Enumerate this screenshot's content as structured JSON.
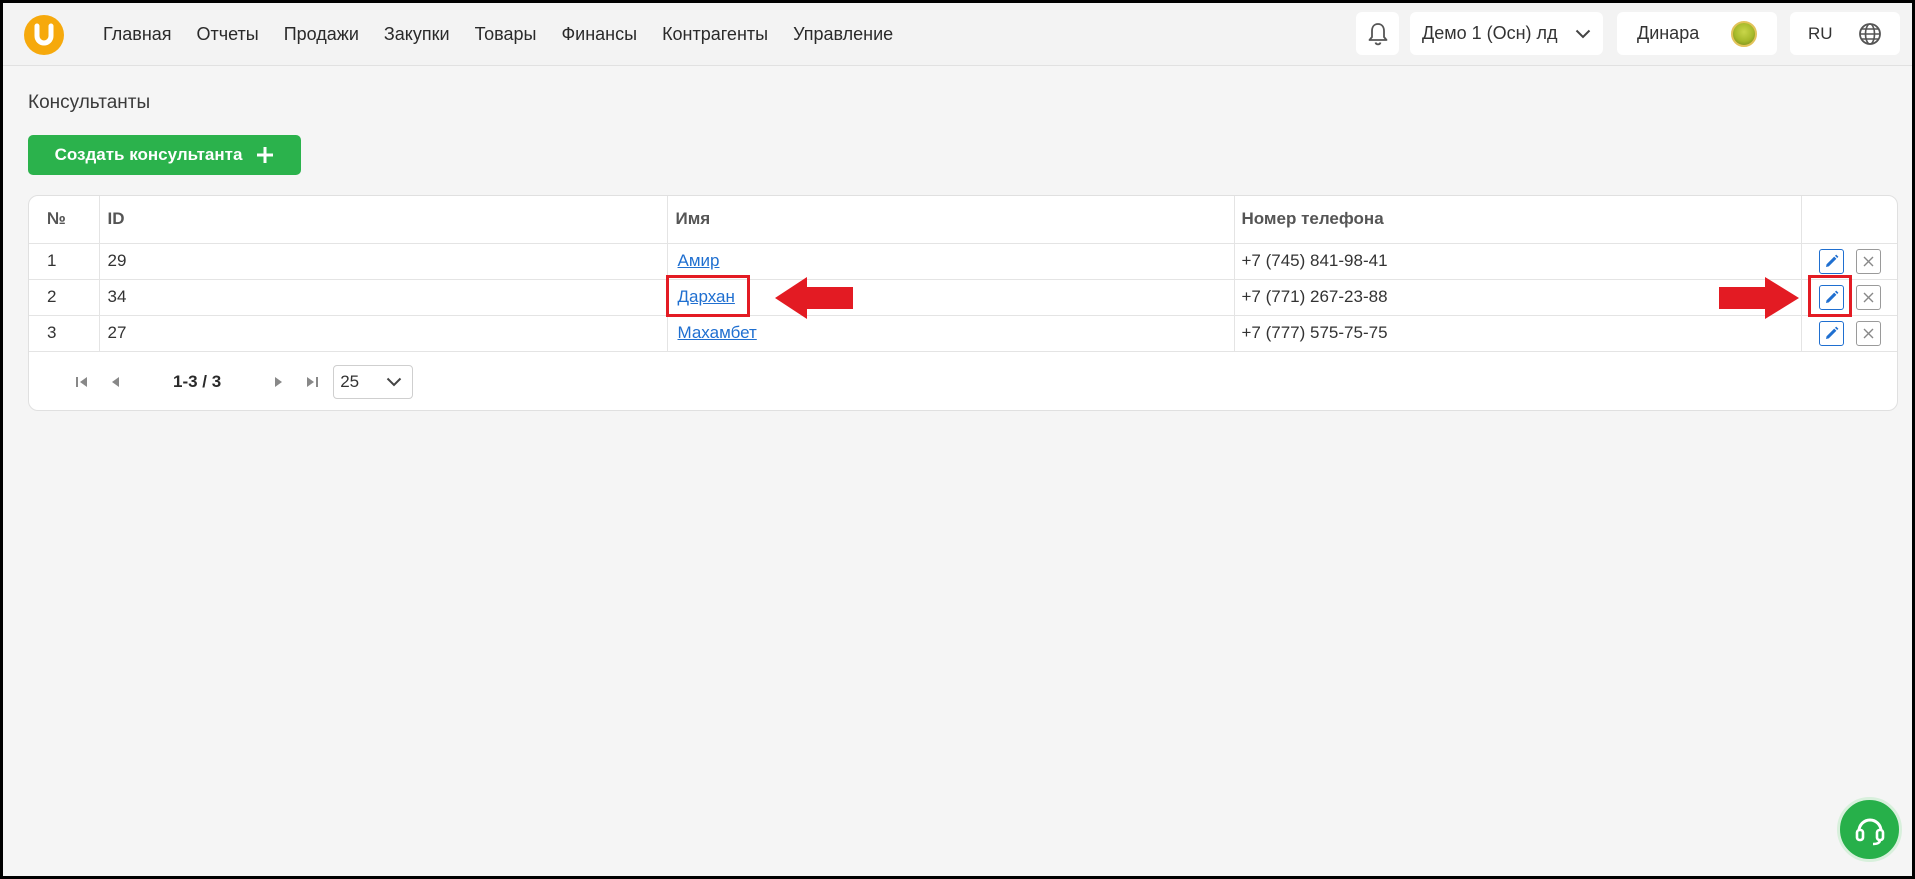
{
  "header": {
    "logo_letter": "U",
    "nav": [
      "Главная",
      "Отчеты",
      "Продажи",
      "Закупки",
      "Товары",
      "Финансы",
      "Контрагенты",
      "Управление"
    ],
    "company": "Демо 1 (Осн) лд",
    "user": "Динара",
    "language": "RU"
  },
  "page": {
    "title": "Консультанты",
    "create_button": "Создать консультанта"
  },
  "table": {
    "headers": [
      "№",
      "ID",
      "Имя",
      "Номер телефона"
    ],
    "rows": [
      {
        "num": "1",
        "id": "29",
        "name": "Амир",
        "phone": "+7 (745) 841-98-41"
      },
      {
        "num": "2",
        "id": "34",
        "name": "Дархан",
        "phone": "+7 (771) 267-23-88"
      },
      {
        "num": "3",
        "id": "27",
        "name": "Махамбет",
        "phone": "+7 (777) 575-75-75"
      }
    ]
  },
  "pagination": {
    "range": "1-3 / 3",
    "per_page": "25"
  },
  "colors": {
    "primary_green": "#2bb24c",
    "link_blue": "#1f6fd0",
    "annotation_red": "#e31b23",
    "logo_orange": "#f6a90c"
  },
  "icons": [
    "bell-icon",
    "chevron-down-icon",
    "globe-icon",
    "plus-icon",
    "edit-icon",
    "close-icon",
    "first-page-icon",
    "prev-page-icon",
    "next-page-icon",
    "last-page-icon",
    "headset-icon"
  ]
}
